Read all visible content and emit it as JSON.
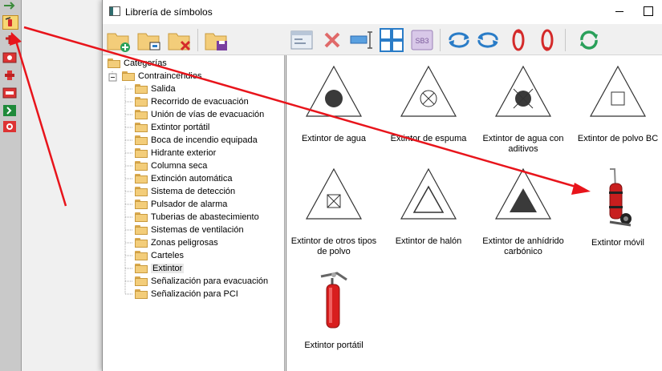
{
  "window": {
    "title": "Librería de símbolos"
  },
  "tree": {
    "root": "Categorías",
    "group": "Contraincendios",
    "items": [
      "Salida",
      "Recorrido de evacuación",
      "Unión de vías de evacuación",
      "Extintor portátil",
      "Boca de incendio equipada",
      "Hidrante exterior",
      "Columna seca",
      "Extinción automática",
      "Sistema de detección",
      "Pulsador de alarma",
      "Tuberias de abastecimiento",
      "Sistemas de ventilación",
      "Zonas peligrosas",
      "Carteles",
      "Extintor",
      "Señalización para evacuación",
      "Señalización para PCI"
    ],
    "selected": "Extintor"
  },
  "toolbar": {
    "sb3_label": "SB3"
  },
  "symbols": [
    {
      "label": "Extintor de agua",
      "icon": "triangle-filled-circle"
    },
    {
      "label": "Extintor de espuma",
      "icon": "triangle-crossed-circle"
    },
    {
      "label": "Extintor de agua con aditivos",
      "icon": "triangle-filled-crossed-circle"
    },
    {
      "label": "Extintor de polvo BC",
      "icon": "triangle-square"
    },
    {
      "label": "Extintor de otros tipos de polvo",
      "icon": "triangle-crossed-square"
    },
    {
      "label": "Extintor de halón",
      "icon": "triangle-in-triangle"
    },
    {
      "label": "Extintor de anhídrido carbónico",
      "icon": "triangle-filled-triangle"
    },
    {
      "label": "Extintor móvil",
      "icon": "wheeled-extinguisher"
    },
    {
      "label": "Extintor portátil",
      "icon": "portable-extinguisher"
    }
  ],
  "colors": {
    "annotation_arrow": "#e8141b",
    "folder": "#f3cd7a",
    "tool_blue": "#2a7cc7",
    "tool_red": "#d42a2a",
    "tool_green": "#2aa05a"
  }
}
